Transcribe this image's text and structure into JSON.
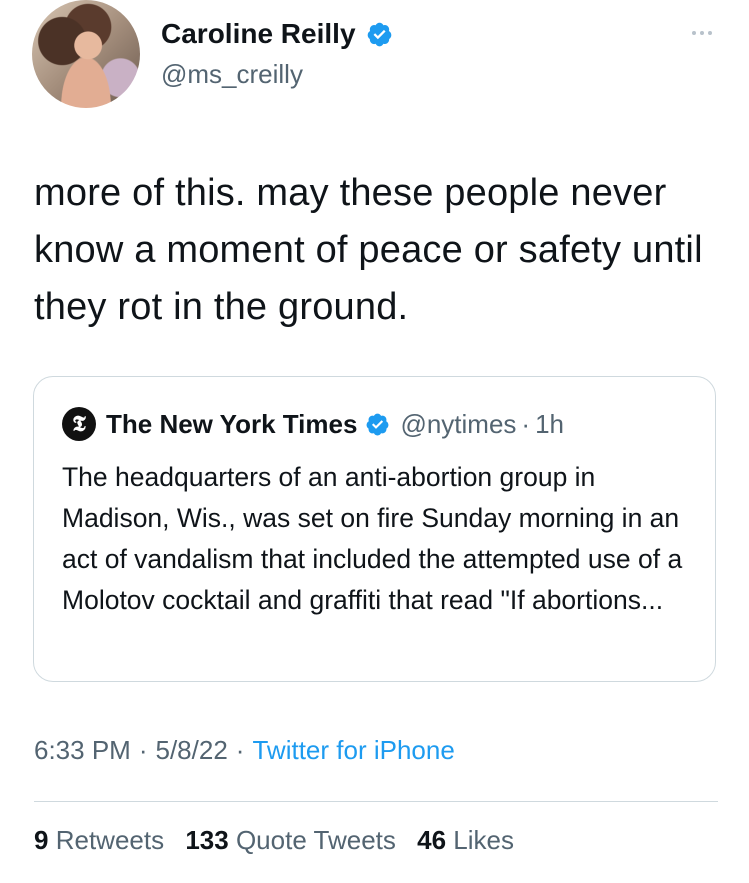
{
  "author": {
    "display_name": "Caroline Reilly",
    "handle": "@ms_creilly",
    "verified": true,
    "icons": [
      "verified-badge-icon",
      "more-options-icon"
    ]
  },
  "tweet": {
    "text": "more of this. may these people never know a moment of peace or safety until they rot in the ground."
  },
  "quoted_tweet": {
    "logo_glyph": "𝕿",
    "display_name": "The New York Times",
    "handle": "@nytimes",
    "separator": "·",
    "time": "1h",
    "text": "The headquarters of an anti-abortion group in Madison, Wis., was set on fire Sunday morning in an act of vandalism that included the attempted use of a Molotov cocktail and graffiti that read \"If abortions..."
  },
  "meta": {
    "time": "6:33 PM",
    "separator": "·",
    "date": "5/8/22",
    "source": "Twitter for iPhone"
  },
  "stats": {
    "retweets_count": "9",
    "retweets_label": "Retweets",
    "quotes_count": "133",
    "quotes_label": "Quote Tweets",
    "likes_count": "46",
    "likes_label": "Likes"
  },
  "colors": {
    "text": "#0f1419",
    "secondary": "#536471",
    "accent": "#1d9bf0",
    "border": "#cfd9de"
  }
}
